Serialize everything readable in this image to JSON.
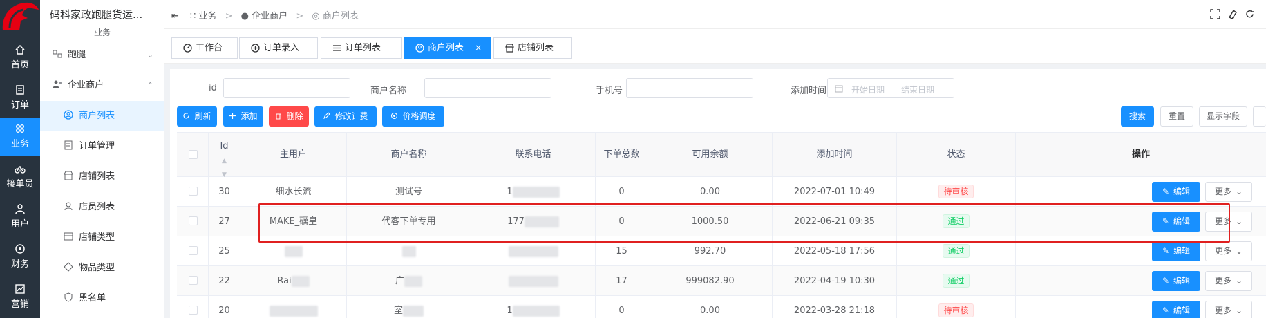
{
  "app": {
    "title": "码科家政跑腿货运...",
    "section_caption": "业务"
  },
  "rail": [
    {
      "label": "首页",
      "icon": "home-icon"
    },
    {
      "label": "订单",
      "icon": "order-icon"
    },
    {
      "label": "业务",
      "icon": "business-icon",
      "active": true
    },
    {
      "label": "接单员",
      "icon": "bike-icon"
    },
    {
      "label": "用户",
      "icon": "user-icon"
    },
    {
      "label": "财务",
      "icon": "finance-icon"
    },
    {
      "label": "营销",
      "icon": "marketing-icon"
    }
  ],
  "sidebar": {
    "items": [
      {
        "label": "跑腿",
        "icon": "errand-icon",
        "expand": "down"
      },
      {
        "label": "企业商户",
        "icon": "merchant-group-icon",
        "expand": "up"
      },
      {
        "label": "商户列表",
        "icon": "merchant-icon",
        "active": true
      },
      {
        "label": "订单管理",
        "icon": "order-manage-icon"
      },
      {
        "label": "店铺列表",
        "icon": "shop-icon"
      },
      {
        "label": "店员列表",
        "icon": "clerk-icon"
      },
      {
        "label": "店铺类型",
        "icon": "shop-type-icon"
      },
      {
        "label": "物品类型",
        "icon": "goods-type-icon"
      },
      {
        "label": "黑名单",
        "icon": "blacklist-icon"
      }
    ]
  },
  "breadcrumb": {
    "items": [
      "业务",
      "企业商户",
      "商户列表"
    ]
  },
  "tabs": [
    {
      "label": "工作台",
      "icon": "dashboard-icon"
    },
    {
      "label": "订单录入",
      "icon": "plus-circle-icon"
    },
    {
      "label": "订单列表",
      "icon": "list-icon"
    },
    {
      "label": "商户列表",
      "icon": "merchant-icon",
      "active": true,
      "close": "×"
    },
    {
      "label": "店铺列表",
      "icon": "shop-icon"
    }
  ],
  "filters": {
    "id_label": "id",
    "name_label": "商户名称",
    "phone_label": "手机号",
    "time_label": "添加时间",
    "start_placeholder": "开始日期",
    "end_placeholder": "结束日期"
  },
  "toolbar": {
    "refresh": "刷新",
    "add": "添加",
    "delete": "删除",
    "edit_billing": "修改计费",
    "price_adjust": "价格调度",
    "search": "搜索",
    "reset": "重置",
    "show_fields": "显示字段"
  },
  "table": {
    "columns": [
      "Id",
      "主用户",
      "商户名称",
      "联系电话",
      "下单总数",
      "可用余额",
      "添加时间",
      "状态",
      "操作"
    ],
    "edit_label": "编辑",
    "more_label": "更多",
    "rows": [
      {
        "id": "30",
        "user": "细水长流",
        "name": "测试号",
        "phone": "1",
        "orders": "0",
        "balance": "0.00",
        "time": "2022-07-01 10:49",
        "status": "待审核",
        "status_type": "pending"
      },
      {
        "id": "27",
        "user": "MAKE_礪皇",
        "name": "代客下单专用",
        "phone": "177",
        "orders": "0",
        "balance": "1000.50",
        "time": "2022-06-21 09:35",
        "status": "通过",
        "status_type": "pass"
      },
      {
        "id": "25",
        "user": "",
        "name": "",
        "phone": "",
        "orders": "15",
        "balance": "992.70",
        "time": "2022-05-18 17:56",
        "status": "通过",
        "status_type": "pass"
      },
      {
        "id": "22",
        "user": "Rai",
        "name": "广",
        "phone": "",
        "orders": "17",
        "balance": "999082.90",
        "time": "2022-04-19 10:30",
        "status": "通过",
        "status_type": "pass"
      },
      {
        "id": "20",
        "user": "",
        "name": "室",
        "phone": "1",
        "orders": "0",
        "balance": "0.00",
        "time": "2022-03-28 21:18",
        "status": "待审核",
        "status_type": "pending"
      }
    ]
  },
  "colors": {
    "primary": "#1890ff",
    "danger": "#ff4949",
    "success": "#13ce66",
    "rail_bg": "#28333e",
    "highlight": "#e02020"
  }
}
